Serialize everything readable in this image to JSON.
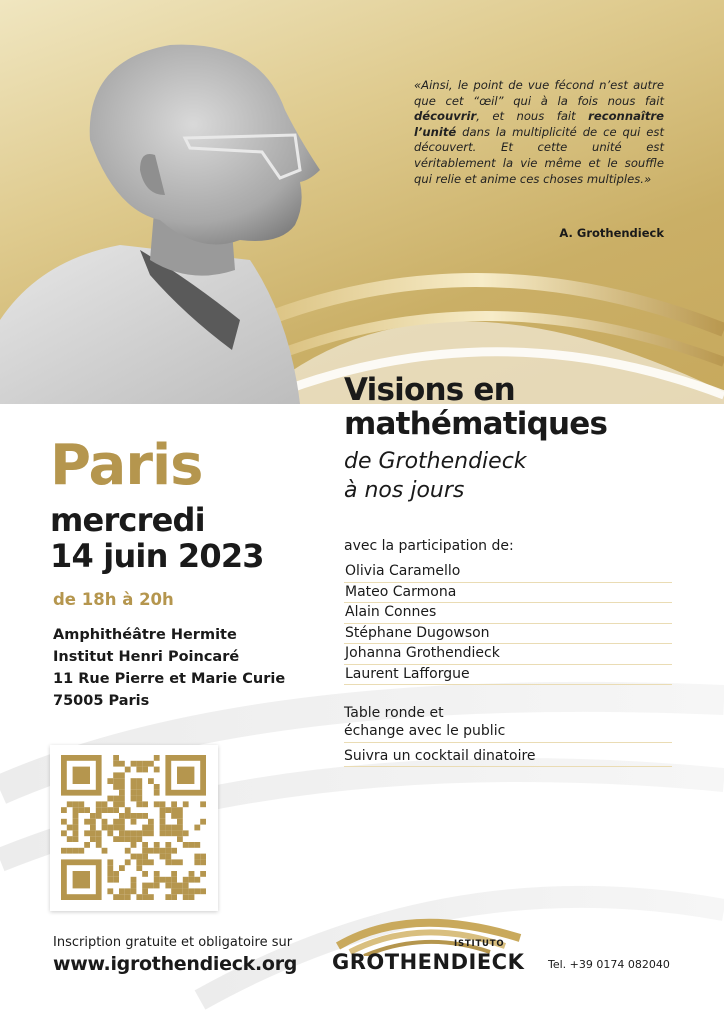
{
  "quote": {
    "parts": [
      {
        "text": "«Ainsi, le point de vue fécond n’est autre que cet “œil” qui à la fois nous fait ",
        "bold": false
      },
      {
        "text": "découvrir",
        "bold": true
      },
      {
        "text": ", et nous fait ",
        "bold": false
      },
      {
        "text": "reconnaître l’unité",
        "bold": true
      },
      {
        "text": " dans la multiplicité de ce qui est découvert. Et cette unité est véritablement la vie même et le souffle qui relie et anime ces choses multiples.»",
        "bold": false
      }
    ],
    "author": "A. Grothendieck"
  },
  "event": {
    "title_line1": "Visions en",
    "title_line2": "mathématiques",
    "subtitle_line1": "de Grothendieck",
    "subtitle_line2": "à nos jours",
    "city": "Paris",
    "date_line1": "mercredi",
    "date_line2": "14 juin 2023",
    "time": "de 18h à 20h",
    "venue": [
      "Amphithéâtre Hermite",
      "Institut Henri Poincaré",
      "11 Rue Pierre et Marie Curie",
      "75005 Paris"
    ]
  },
  "participation": {
    "label": "avec la participation de:",
    "participants": [
      "Olivia Caramello",
      "Mateo Carmona",
      "Alain Connes",
      "Stéphane Dugowson",
      "Johanna Grothendieck",
      "Laurent Lafforgue"
    ],
    "roundtable_line1": "Table ronde et",
    "roundtable_line2": "échange avec le public",
    "cocktail": "Suivra un cocktail dinatoire"
  },
  "registration": {
    "signup": "Inscription gratuite et obligatoire sur",
    "website": "www.igrothendieck.org"
  },
  "footer": {
    "logo_small": "ISTITUTO",
    "logo_big": "GROTHENDIECK",
    "phone": "Tel. +39 0174 082040"
  },
  "colors": {
    "gold": "#b5964e",
    "dark": "#1a1a1a",
    "band": "#d6c07e"
  },
  "icons": {
    "portrait": "portrait-photo",
    "qr": "qr-code-icon",
    "logo": "istituto-grothendieck-logo"
  }
}
